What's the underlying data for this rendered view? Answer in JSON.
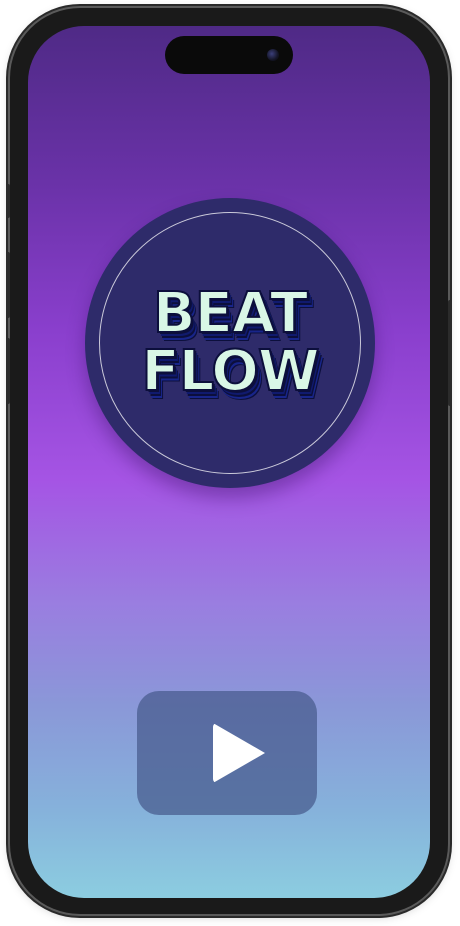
{
  "app": {
    "logo_line_1": "BEAT",
    "logo_line_2": "FLOW"
  },
  "icons": {
    "play": "play-icon",
    "camera": "camera-lens-icon"
  },
  "colors": {
    "gradient_top": "#4f2a86",
    "gradient_mid": "#a554e4",
    "gradient_bottom": "#8ccde0",
    "logo_disc": "#2e2b6a",
    "logo_text_fill": "#d9f7e6",
    "logo_text_outline": "#0c0f3c",
    "play_button_bg": "#465a8c",
    "play_icon": "#ffffff"
  }
}
